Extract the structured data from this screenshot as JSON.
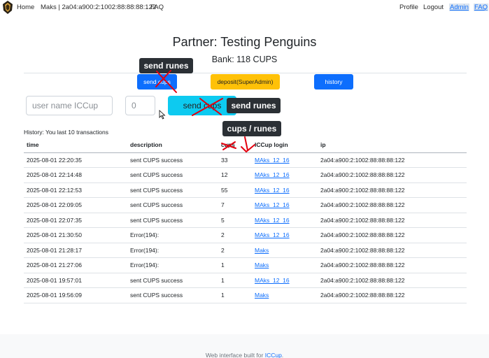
{
  "nav": {
    "home": "Home",
    "user": "Maks | 2a04:a900:2:1002:88:88:88:122",
    "faq": "FAQ",
    "profile": "Profile",
    "logout": "Logout",
    "admin": "Admin",
    "faq_right": "FAQ"
  },
  "header": {
    "title": "Partner: Testing Penguins",
    "bank": "Bank: 118 CUPS"
  },
  "actions": {
    "send_cups": "send cups",
    "deposit": "deposit(SuperAdmin)",
    "history": "history"
  },
  "form": {
    "username_placeholder": "user name ICCup",
    "amount_placeholder": "0",
    "send_button": "send cups"
  },
  "annotations": {
    "send_runes_top": "send runes",
    "send_runes_right": "send runes",
    "cups_runes": "cups / runes"
  },
  "history": {
    "caption": "History: You last 10 transactions",
    "columns": [
      "time",
      "description",
      "cups",
      "ICCup login",
      "ip"
    ],
    "rows": [
      {
        "time": "2025-08-01 22:20:35",
        "description": "sent CUPS success",
        "cups": "33",
        "login": "MAks_12_16",
        "ip": "2a04:a900:2:1002:88:88:88:122"
      },
      {
        "time": "2025-08-01 22:14:48",
        "description": "sent CUPS success",
        "cups": "12",
        "login": "MAks_12_16",
        "ip": "2a04:a900:2:1002:88:88:88:122"
      },
      {
        "time": "2025-08-01 22:12:53",
        "description": "sent CUPS success",
        "cups": "55",
        "login": "MAks_12_16",
        "ip": "2a04:a900:2:1002:88:88:88:122"
      },
      {
        "time": "2025-08-01 22:09:05",
        "description": "sent CUPS success",
        "cups": "7",
        "login": "MAks_12_16",
        "ip": "2a04:a900:2:1002:88:88:88:122"
      },
      {
        "time": "2025-08-01 22:07:35",
        "description": "sent CUPS success",
        "cups": "5",
        "login": "MAks_12_16",
        "ip": "2a04:a900:2:1002:88:88:88:122"
      },
      {
        "time": "2025-08-01 21:30:50",
        "description": "Error(194):",
        "cups": "2",
        "login": "MAks_12_16",
        "ip": "2a04:a900:2:1002:88:88:88:122"
      },
      {
        "time": "2025-08-01 21:28:17",
        "description": "Error(194):",
        "cups": "2",
        "login": "Maks",
        "ip": "2a04:a900:2:1002:88:88:88:122"
      },
      {
        "time": "2025-08-01 21:27:06",
        "description": "Error(194):",
        "cups": "1",
        "login": "Maks",
        "ip": "2a04:a900:2:1002:88:88:88:122"
      },
      {
        "time": "2025-08-01 19:57:01",
        "description": "sent CUPS success",
        "cups": "1",
        "login": "MAks_12_16",
        "ip": "2a04:a900:2:1002:88:88:88:122"
      },
      {
        "time": "2025-08-01 19:56:09",
        "description": "sent CUPS success",
        "cups": "1",
        "login": "Maks",
        "ip": "2a04:a900:2:1002:88:88:88:122"
      }
    ]
  },
  "footer": {
    "text": "Web interface built for ",
    "link": "ICCup",
    "suffix": "."
  },
  "colors": {
    "primary": "#0d6efd",
    "warning": "#ffc107",
    "info": "#0dcaf0",
    "tooltip": "#2b3035",
    "markup_red": "#e3000f"
  }
}
